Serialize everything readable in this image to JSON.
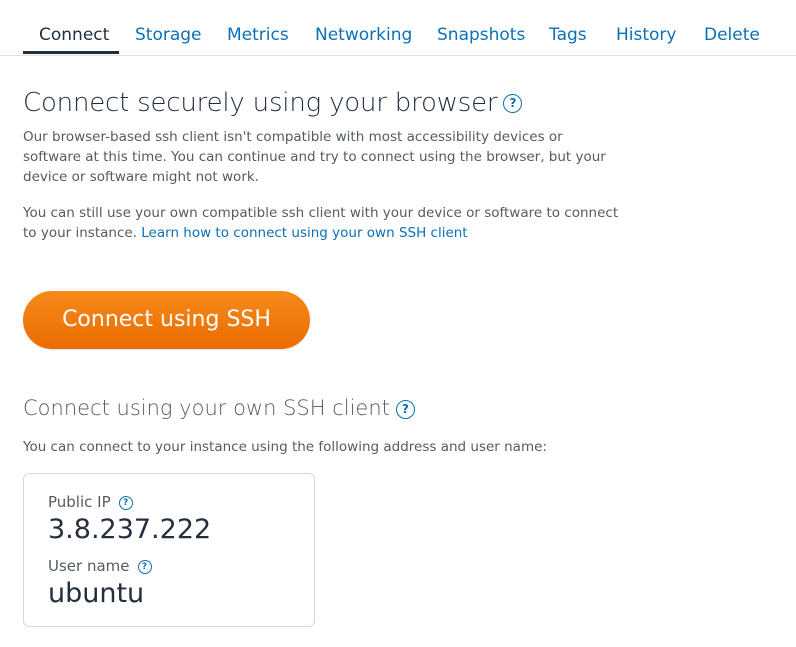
{
  "tabs": [
    {
      "label": "Connect",
      "active": true
    },
    {
      "label": "Storage"
    },
    {
      "label": "Metrics"
    },
    {
      "label": "Networking"
    },
    {
      "label": "Snapshots"
    },
    {
      "label": "Tags"
    },
    {
      "label": "History"
    },
    {
      "label": "Delete"
    }
  ],
  "browser_section": {
    "title": "Connect securely using your browser",
    "help_icon": "question-circle-icon",
    "paragraph1": "Our browser-based ssh client isn't compatible with most accessibility devices or software at this time. You can continue and try to connect using the browser, but your device or software might not work.",
    "paragraph2_text": "You can still use your own compatible ssh client with your device or software to connect to your instance. ",
    "paragraph2_link": "Learn how to connect using your own SSH client",
    "button_label": "Connect using SSH"
  },
  "own_client_section": {
    "title": "Connect using your own SSH client",
    "description": "You can connect to your instance using the following address and user name:",
    "public_ip_label": "Public IP",
    "public_ip_value": "3.8.237.222",
    "username_label": "User name",
    "username_value": "ubuntu"
  },
  "colors": {
    "accent": "#0b70b6",
    "button": "#ef7b0c",
    "text": "#232f3e"
  }
}
